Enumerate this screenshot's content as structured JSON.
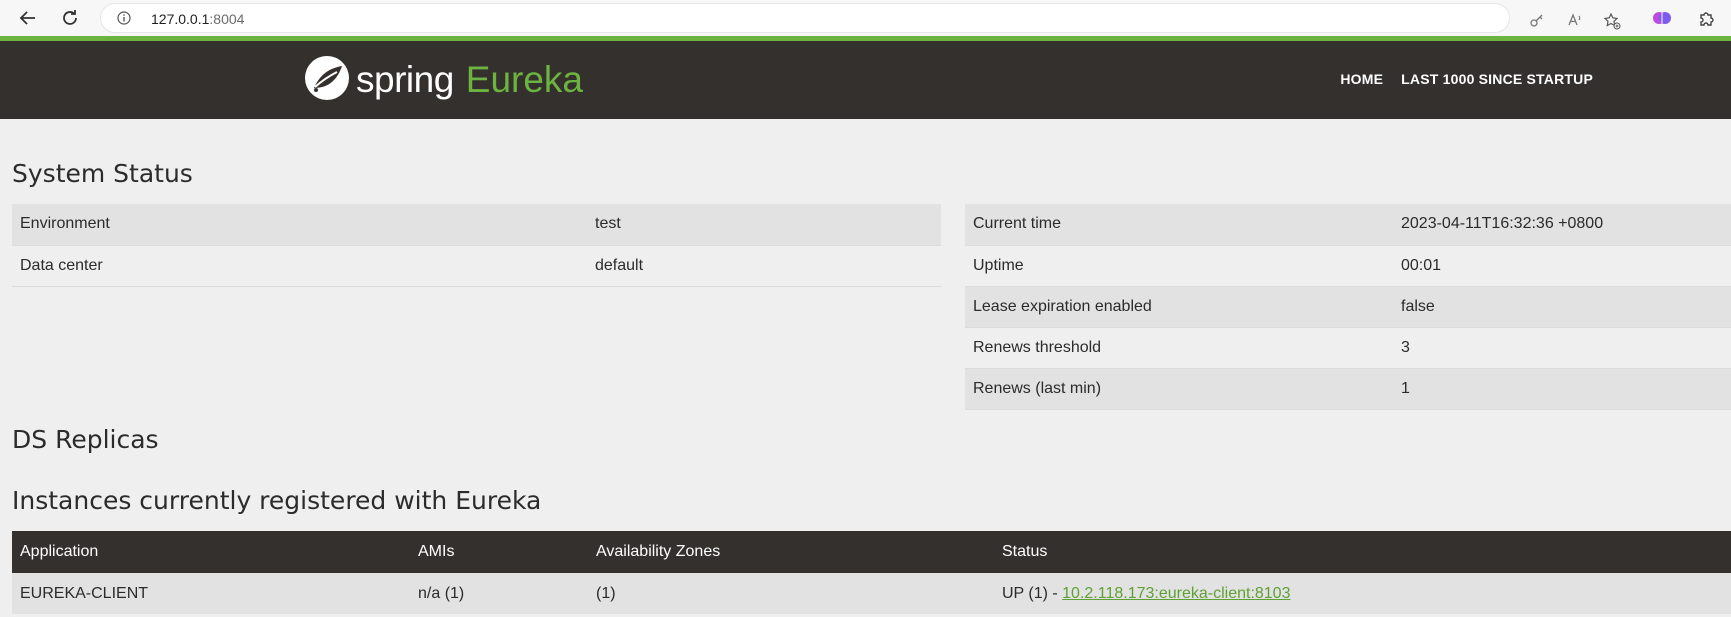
{
  "browser": {
    "url_host": "127.0.0.1",
    "url_port": ":8004"
  },
  "header": {
    "brand_word": "spring",
    "product_word": "Eureka",
    "nav": [
      {
        "label": "HOME"
      },
      {
        "label": "LAST 1000 SINCE STARTUP"
      }
    ],
    "colors": {
      "bar": "#34302d",
      "accent": "#6db33f"
    }
  },
  "system_status": {
    "title": "System Status",
    "left": [
      {
        "key": "Environment",
        "value": "test"
      },
      {
        "key": "Data center",
        "value": "default"
      }
    ],
    "right": [
      {
        "key": "Current time",
        "value": "2023-04-11T16:32:36 +0800"
      },
      {
        "key": "Uptime",
        "value": "00:01"
      },
      {
        "key": "Lease expiration enabled",
        "value": "false"
      },
      {
        "key": "Renews threshold",
        "value": "3"
      },
      {
        "key": "Renews (last min)",
        "value": "1"
      }
    ]
  },
  "ds_replicas": {
    "title": "DS Replicas"
  },
  "instances": {
    "title": "Instances currently registered with Eureka",
    "columns": [
      "Application",
      "AMIs",
      "Availability Zones",
      "Status"
    ],
    "rows": [
      {
        "application": "EUREKA-CLIENT",
        "amis": "n/a (1)",
        "zones": "(1)",
        "status_prefix": "UP (1) - ",
        "status_link": "10.2.118.173:eureka-client:8103"
      }
    ]
  }
}
